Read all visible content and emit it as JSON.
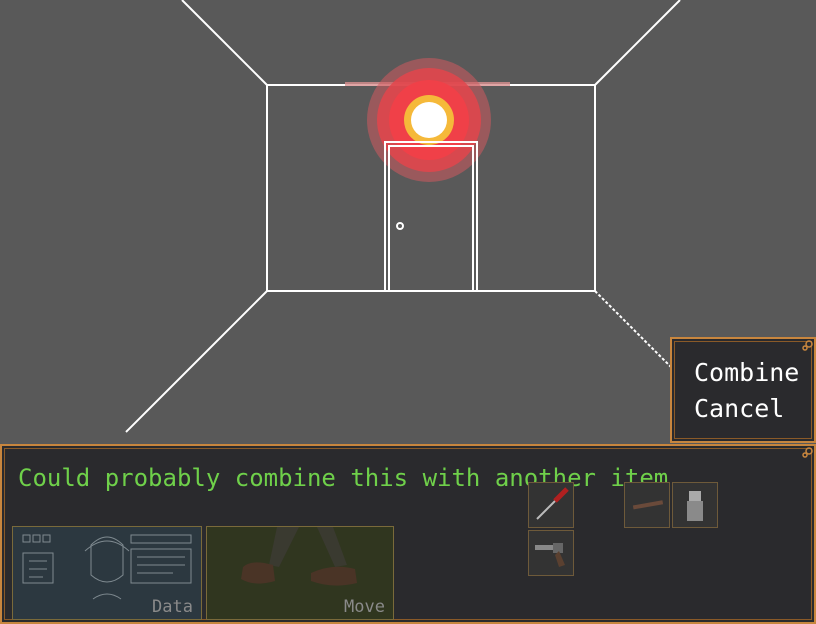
{
  "combine_menu": {
    "combine_label": "Combine",
    "cancel_label": "Cancel"
  },
  "message": {
    "text": "Could probably combine this with another item."
  },
  "cards": {
    "data_label": "Data",
    "move_label": "Move"
  },
  "inventory": {
    "items": [
      "screwdriver-icon",
      "revolver-icon",
      "stick-icon",
      "lighter-icon"
    ]
  },
  "colors": {
    "panel_border": "#c8863e",
    "message_text": "#6fd04a",
    "light_glow": "#e8464a",
    "light_core": "#f5b93a"
  }
}
